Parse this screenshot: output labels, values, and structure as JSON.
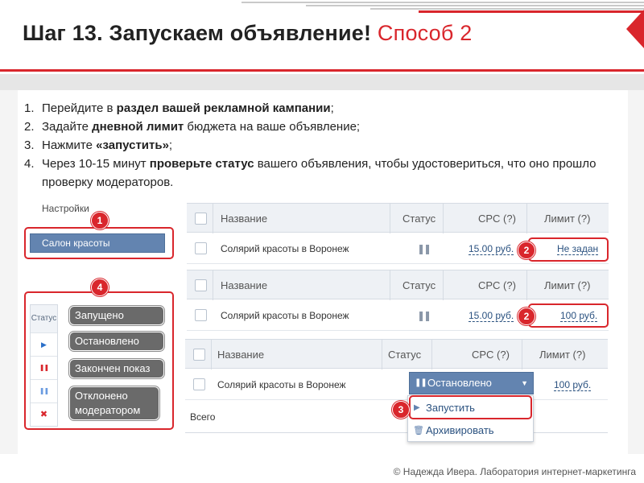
{
  "slide": {
    "title_main": "Шаг 13. Запускаем объявление!",
    "title_accent": "Способ 2",
    "footer": "© Надежда Ивера. Лаборатория интернет-маркетинга"
  },
  "steps": [
    {
      "num": "1.",
      "pre": "Перейдите в ",
      "bold": "раздел вашей рекламной кампании",
      "post": ";"
    },
    {
      "num": "2.",
      "pre": "Задайте ",
      "bold": "дневной лимит",
      "post": " бюджета на ваше объявление;"
    },
    {
      "num": "3.",
      "pre": "Нажмите ",
      "bold": "«запустить»",
      "post": ";"
    },
    {
      "num": "4.",
      "pre": "Через 10-15 минут ",
      "bold": "проверьте статус",
      "post": " вашего объявления, чтобы удостовериться, что оно прошло проверку модераторов."
    }
  ],
  "settings": {
    "label": "Настройки",
    "campaign_name": "Салон красоты"
  },
  "badges": {
    "b1": "1",
    "b2": "2",
    "b3": "3",
    "b4": "4"
  },
  "status_legend": {
    "header": "Статус",
    "items": [
      {
        "icon": "play-icon",
        "symbol": "▶",
        "color": "#2a6fc9",
        "label": "Запущено"
      },
      {
        "icon": "pause-red-icon",
        "symbol": "❚❚",
        "color": "#d9262c",
        "label": "Остановлено"
      },
      {
        "icon": "pause-blue-icon",
        "symbol": "❚❚",
        "color": "#6a9be0",
        "label": "Закончен показ"
      },
      {
        "icon": "cross-icon",
        "symbol": "✖",
        "color": "#d9262c",
        "label": "Отклонено модератором"
      }
    ]
  },
  "table": {
    "columns": {
      "name": "Название",
      "status": "Статус",
      "cpc": "CPC (?)",
      "limit": "Лимит (?)"
    },
    "ad_name": "Солярий красоты в Воронеж",
    "cpc_value": "15.00 руб.",
    "limit_unset": "Не задан",
    "limit_set": "100 руб."
  },
  "dropdown": {
    "selected": "Остановлено",
    "items": [
      "Запустить",
      "Архивировать"
    ]
  },
  "total_label": "Всего",
  "colors": {
    "accent": "#d9262c",
    "button_blue": "#6384b0",
    "link": "#2b5280"
  }
}
